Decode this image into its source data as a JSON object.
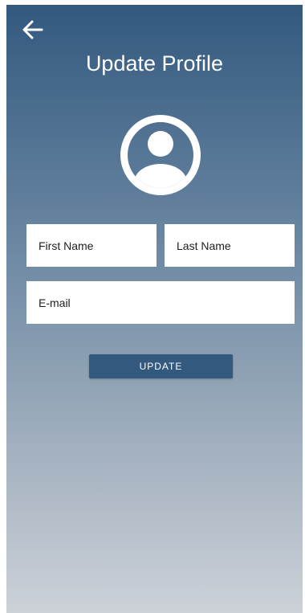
{
  "header": {
    "back_icon": "arrow-left-icon",
    "title": "Update Profile"
  },
  "avatar": {
    "icon": "account-circle-icon"
  },
  "form": {
    "first_name_placeholder": "First Name",
    "last_name_placeholder": "Last Name",
    "email_placeholder": "E-mail",
    "first_name_value": "",
    "last_name_value": "",
    "email_value": ""
  },
  "actions": {
    "update_label": "UPDATE"
  },
  "colors": {
    "accent": "#33597f",
    "gradient_top": "#33597f",
    "gradient_bottom": "#cdd2d8",
    "text_light": "#ffffff"
  }
}
